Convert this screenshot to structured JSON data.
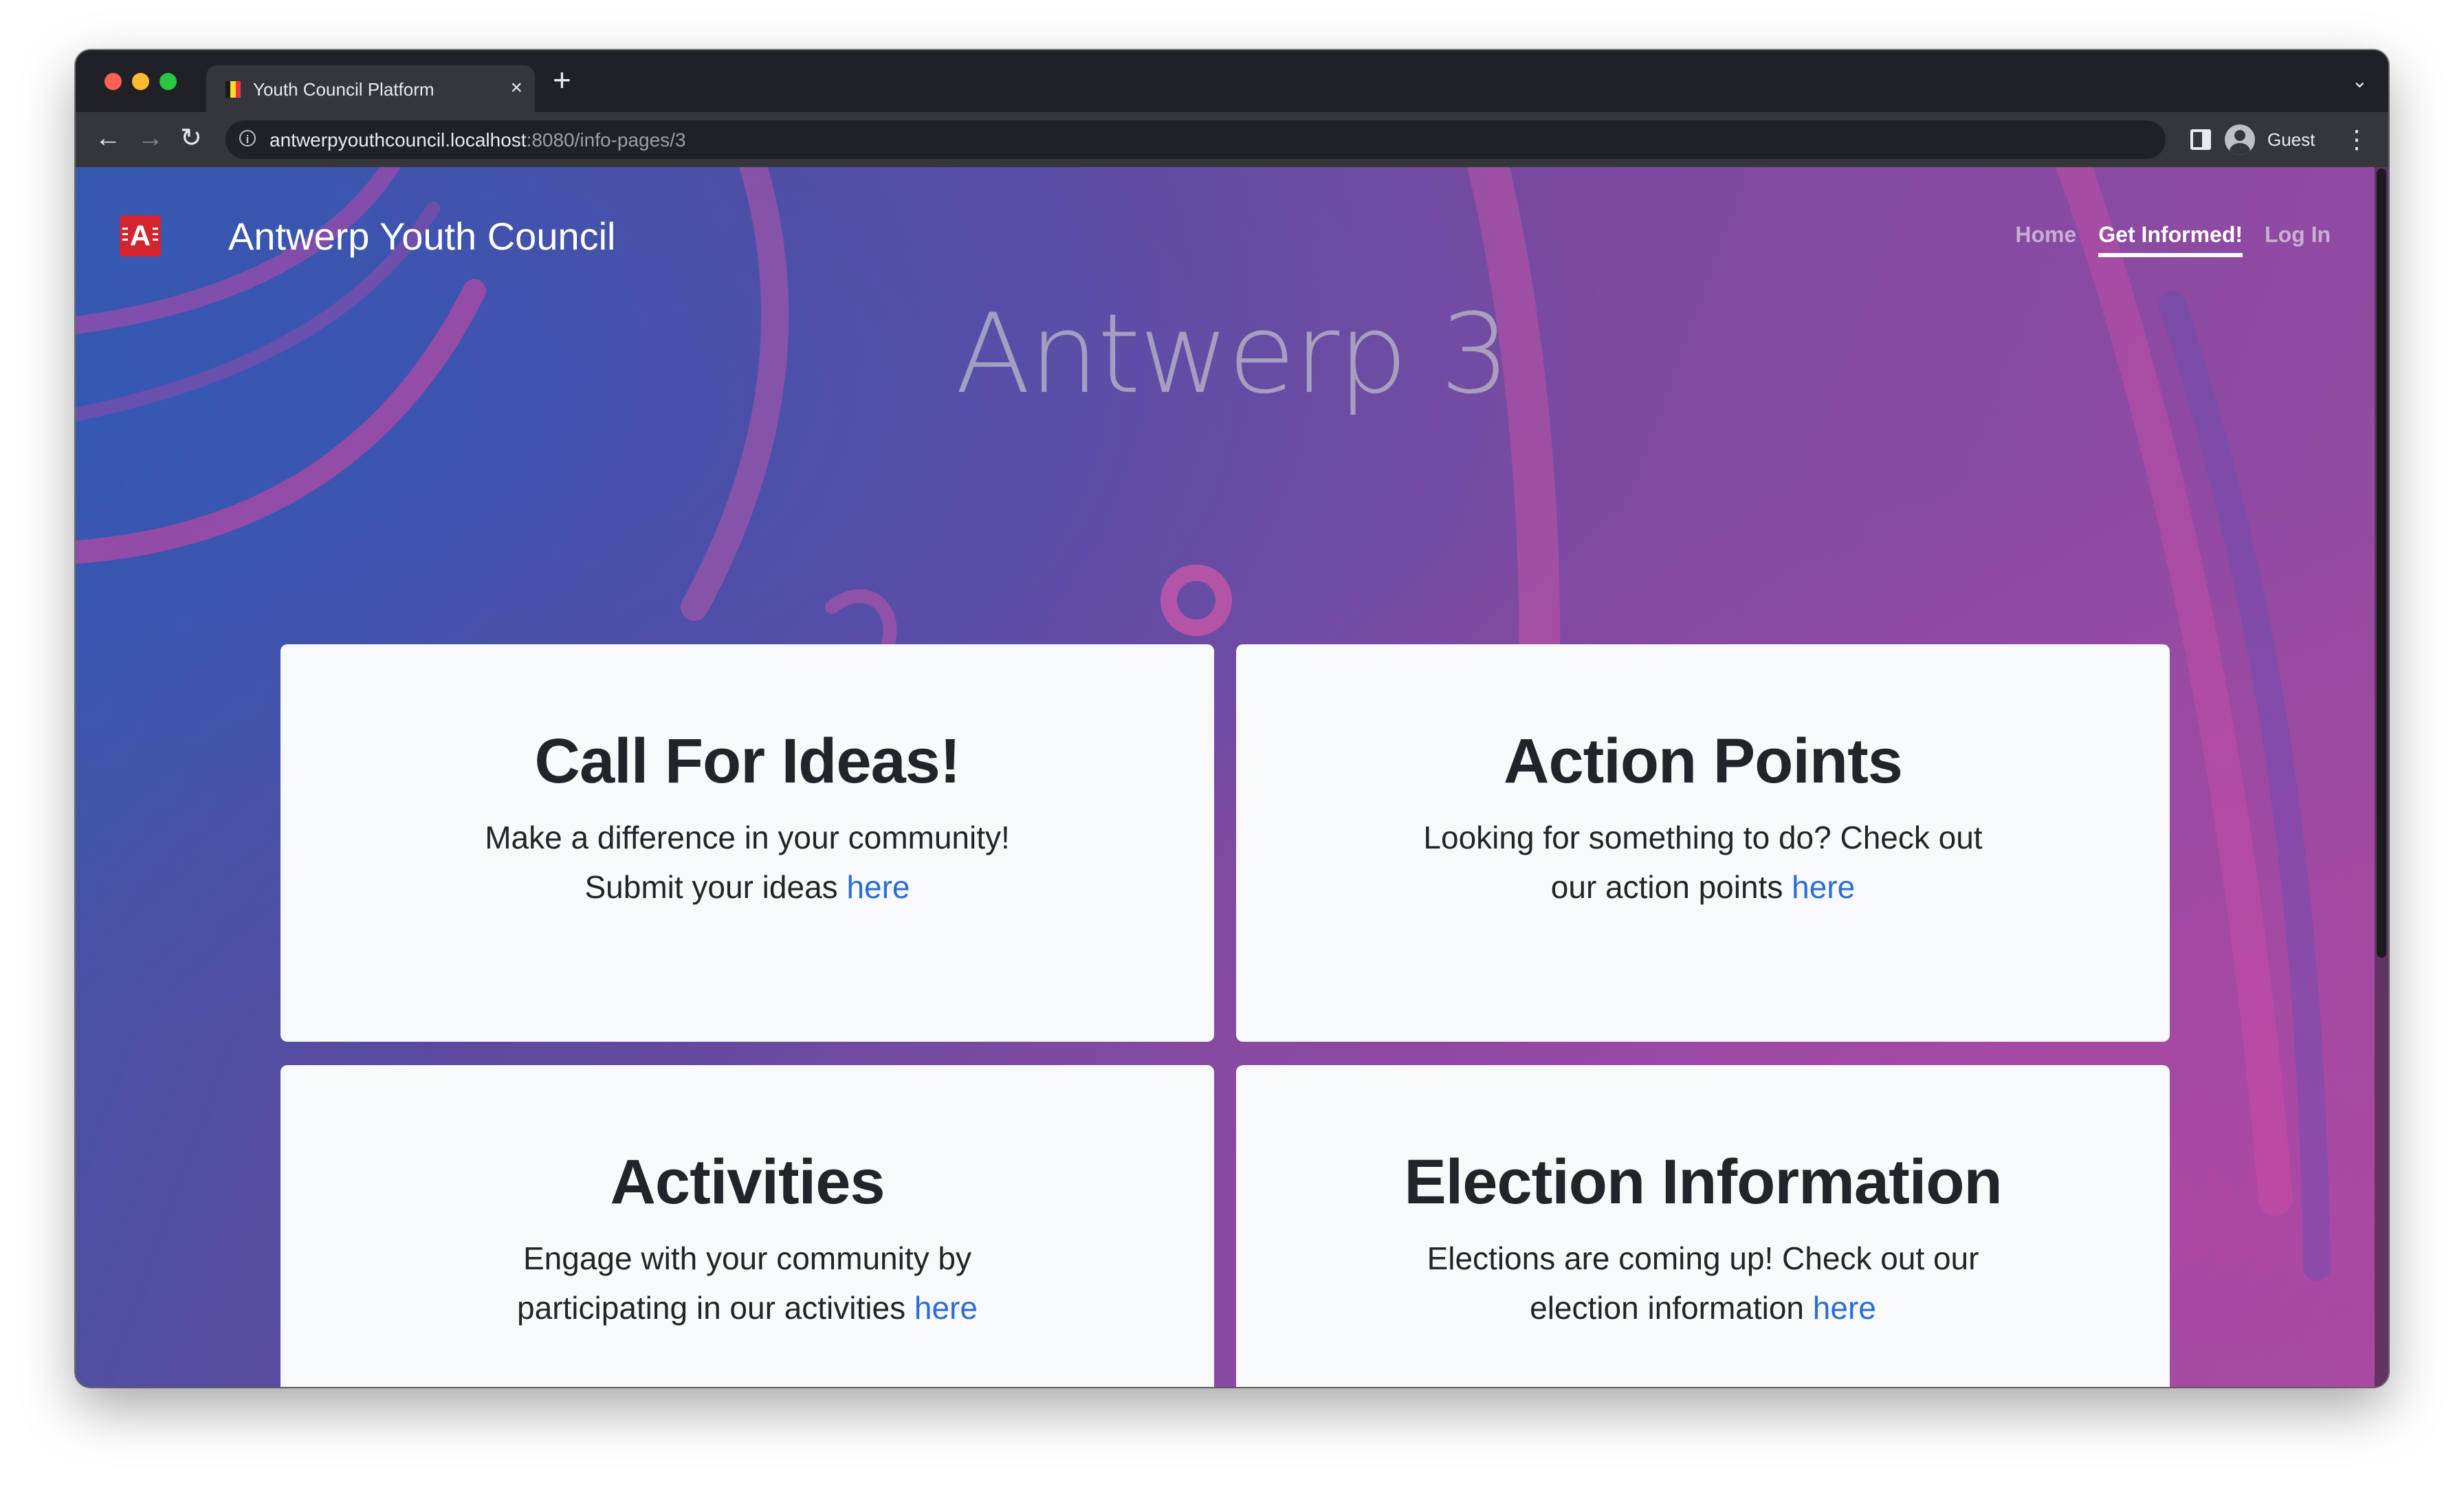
{
  "browser": {
    "tab_title": "Youth Council Platform",
    "tab_close": "×",
    "new_tab": "+",
    "tab_menu": "⌄",
    "nav_back": "←",
    "nav_forward": "→",
    "nav_reload": "↻",
    "url_host": "antwerpyouthcouncil.localhost",
    "url_rest": ":8080/info-pages/3",
    "profile_name": "Guest",
    "menu": "⋮"
  },
  "site": {
    "logo_letter": "A",
    "brand": "Antwerp Youth Council",
    "nav": [
      {
        "label": "Home"
      },
      {
        "label": "Get Informed!"
      },
      {
        "label": "Log In"
      }
    ]
  },
  "page": {
    "title": "Antwerp 3"
  },
  "cards": [
    {
      "title": "Call For Ideas!",
      "text": "Make a difference in your community! Submit your ideas ",
      "link": "here"
    },
    {
      "title": "Action Points",
      "text": "Looking for something to do? Check out our action points ",
      "link": "here"
    },
    {
      "title": "Activities",
      "text": "Engage with your community by participating in our activities ",
      "link": "here"
    },
    {
      "title": "Election Information",
      "text": "Elections are coming up! Check out our election information ",
      "link": "here"
    }
  ],
  "colors": {
    "link": "#2a6dd9",
    "logo": "#d4242f",
    "background_start": "#3b58a8",
    "background_end": "#9c4a9f"
  }
}
